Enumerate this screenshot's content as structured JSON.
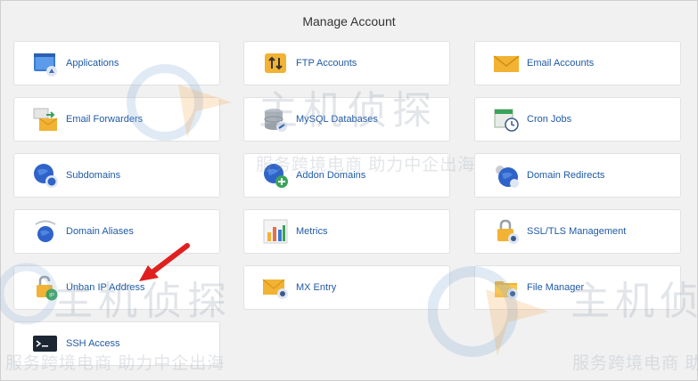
{
  "page": {
    "title": "Manage Account"
  },
  "tiles": [
    {
      "label": "Applications",
      "icon": "applications-icon"
    },
    {
      "label": "FTP Accounts",
      "icon": "ftp-accounts-icon"
    },
    {
      "label": "Email Accounts",
      "icon": "email-accounts-icon"
    },
    {
      "label": "Email Forwarders",
      "icon": "email-forwarders-icon"
    },
    {
      "label": "MySQL Databases",
      "icon": "mysql-databases-icon"
    },
    {
      "label": "Cron Jobs",
      "icon": "cron-jobs-icon"
    },
    {
      "label": "Subdomains",
      "icon": "subdomains-icon"
    },
    {
      "label": "Addon Domains",
      "icon": "addon-domains-icon"
    },
    {
      "label": "Domain Redirects",
      "icon": "domain-redirects-icon"
    },
    {
      "label": "Domain Aliases",
      "icon": "domain-aliases-icon"
    },
    {
      "label": "Metrics",
      "icon": "metrics-icon"
    },
    {
      "label": "SSL/TLS Management",
      "icon": "ssl-tls-icon"
    },
    {
      "label": "Unban IP Address",
      "icon": "unban-ip-icon"
    },
    {
      "label": "MX Entry",
      "icon": "mx-entry-icon"
    },
    {
      "label": "File Manager",
      "icon": "file-manager-icon"
    },
    {
      "label": "SSH Access",
      "icon": "ssh-access-icon"
    }
  ],
  "watermark": {
    "brand": "主机侦探",
    "slogan": "服务跨境电商 助力中企出海"
  },
  "colors": {
    "link": "#1f5aa6",
    "arrow": "#e02020",
    "globe": "#2f63c9",
    "envelope": "#f2b233"
  }
}
